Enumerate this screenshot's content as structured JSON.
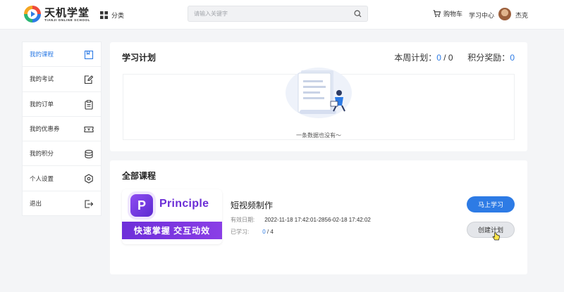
{
  "header": {
    "logo_title": "天机学堂",
    "logo_subtitle": "TIANJI ONLINE SCHOOL",
    "category_label": "分类",
    "search_placeholder": "请输入关键字",
    "cart_label": "购物车",
    "study_center_label": "学习中心",
    "username": "杰克"
  },
  "sidebar": {
    "items": [
      {
        "label": "我的课程",
        "icon": "course-icon",
        "active": true
      },
      {
        "label": "我的考试",
        "icon": "exam-edit-icon",
        "active": false
      },
      {
        "label": "我的订单",
        "icon": "order-clipboard-icon",
        "active": false
      },
      {
        "label": "我的优惠券",
        "icon": "coupon-ticket-icon",
        "active": false
      },
      {
        "label": "我的积分",
        "icon": "points-stack-icon",
        "active": false
      },
      {
        "label": "个人设置",
        "icon": "settings-hexagon-icon",
        "active": false
      },
      {
        "label": "退出",
        "icon": "logout-icon",
        "active": false
      }
    ]
  },
  "plan": {
    "title": "学习计划",
    "week_plan_label": "本周计划：",
    "week_plan_done": "0",
    "week_plan_sep": " / ",
    "week_plan_total": "0",
    "points_label": "积分奖励：",
    "points_value": "0",
    "empty_text": "一条数据也没有～"
  },
  "courses": {
    "title": "全部课程",
    "items": [
      {
        "cover_brand": "Principle",
        "cover_tagline": "快速掌握 交互动效",
        "name": "短视频制作",
        "validity_label": "有效日期:",
        "validity_value": "2022-11-18 17:42:01-2856-02-18 17:42:02",
        "progress_label": "已学习:",
        "progress_done": "0",
        "progress_total": " / 4",
        "study_button": "马上学习",
        "plan_button": "创建计划"
      }
    ]
  },
  "colors": {
    "accent": "#2d7be5",
    "page_bg": "#f4f5f7",
    "cover_purple": "#6e2fd9"
  }
}
